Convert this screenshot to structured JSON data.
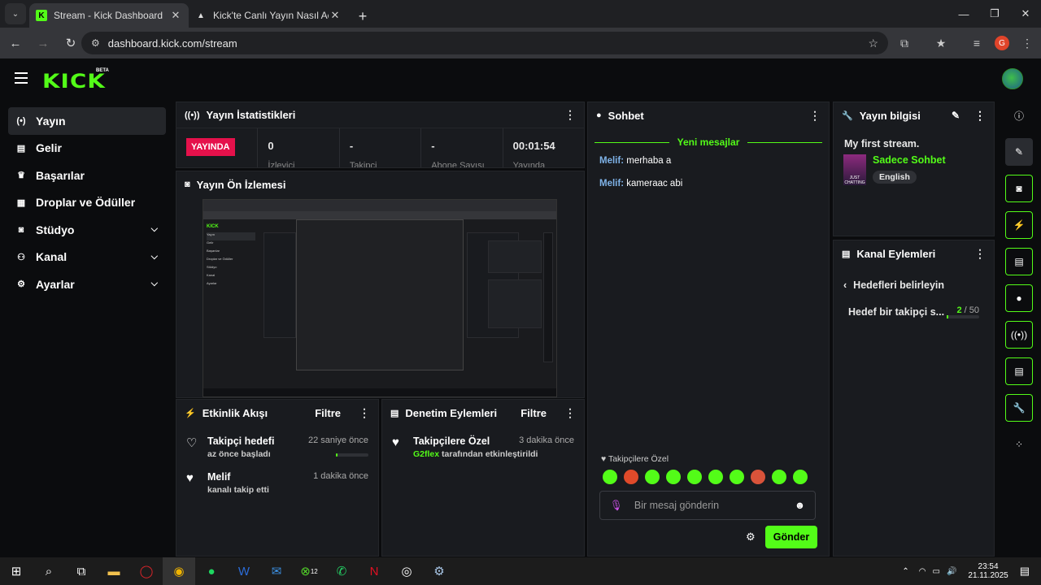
{
  "browser": {
    "tabs": [
      {
        "title": "Stream - Kick Dashboard",
        "active": true
      },
      {
        "title": "Kick'te Canlı Yayın Nasıl Açılır? |",
        "active": false
      }
    ],
    "url": "dashboard.kick.com/stream",
    "profile_initial": "G"
  },
  "header": {
    "logo": "KICK",
    "beta": "BETA"
  },
  "sidebar": {
    "items": [
      {
        "label": "Yayın",
        "icon": "broadcast-icon",
        "glyph": "(•)",
        "active": true
      },
      {
        "label": "Gelir",
        "icon": "chart-icon",
        "glyph": "▤"
      },
      {
        "label": "Başarılar",
        "icon": "trophy-icon",
        "glyph": "🏆"
      },
      {
        "label": "Droplar ve Ödüller",
        "icon": "gift-icon",
        "glyph": "▦"
      },
      {
        "label": "Stüdyo",
        "icon": "studio-icon",
        "glyph": "◙",
        "chevron": true
      },
      {
        "label": "Kanal",
        "icon": "users-icon",
        "glyph": "👥",
        "chevron": true
      },
      {
        "label": "Ayarlar",
        "icon": "gear-icon",
        "glyph": "⚙",
        "chevron": true
      }
    ]
  },
  "stats_panel": {
    "title": "Yayın İstatistikleri",
    "live_badge": "YAYINDA",
    "items": [
      {
        "value": "0",
        "label": "İzleyici"
      },
      {
        "value": "-",
        "label": "Takipçi"
      },
      {
        "value": "-",
        "label": "Abone Sayısı"
      },
      {
        "value": "00:01:54",
        "label": "Yayında"
      }
    ]
  },
  "preview_panel": {
    "title": "Yayın Ön İzlemesi"
  },
  "activity_panel": {
    "title": "Etkinlik Akışı",
    "filter": "Filtre",
    "items": [
      {
        "title": "Takipçi hedefi",
        "sub": "az önce başladı",
        "time": "22 saniye önce",
        "progress": 0.05
      },
      {
        "title": "Melif",
        "sub": "kanalı takip etti",
        "time": "1 dakika önce"
      }
    ]
  },
  "moderation_panel": {
    "title": "Denetim Eylemleri",
    "filter": "Filtre",
    "items": [
      {
        "title": "Takipçilere Özel",
        "user": "G2flex",
        "sub": "tarafından etkinleştirildi",
        "time": "3 dakika önce"
      }
    ]
  },
  "chat_panel": {
    "title": "Sohbet",
    "new_messages": "Yeni mesajlar",
    "messages": [
      {
        "user": "Melif",
        "text": "merhaba a"
      },
      {
        "user": "Melif",
        "text": "kameraac abi"
      }
    ],
    "mode": "Takipçilere Özel",
    "placeholder": "Bir mesaj gönderin",
    "send": "Gönder"
  },
  "info_panel": {
    "title": "Yayın bilgisi",
    "stream_title": "My first stream.",
    "category": "Sadece Sohbet",
    "language": "English",
    "thumb_text": "JUST CHATTING"
  },
  "channel_actions": {
    "title": "Kanal Eylemleri",
    "back_label": "Hedefleri belirleyin",
    "goal_label": "Hedef bir takipçi s...",
    "goal_current": "2",
    "goal_total": "/ 50",
    "goal_fraction": 0.04
  },
  "taskbar": {
    "time": "23:54",
    "date": "21.11.2025",
    "badge": "12"
  },
  "colors": {
    "accent": "#53fc18",
    "live": "#e5114b",
    "panel": "#191b1f"
  }
}
